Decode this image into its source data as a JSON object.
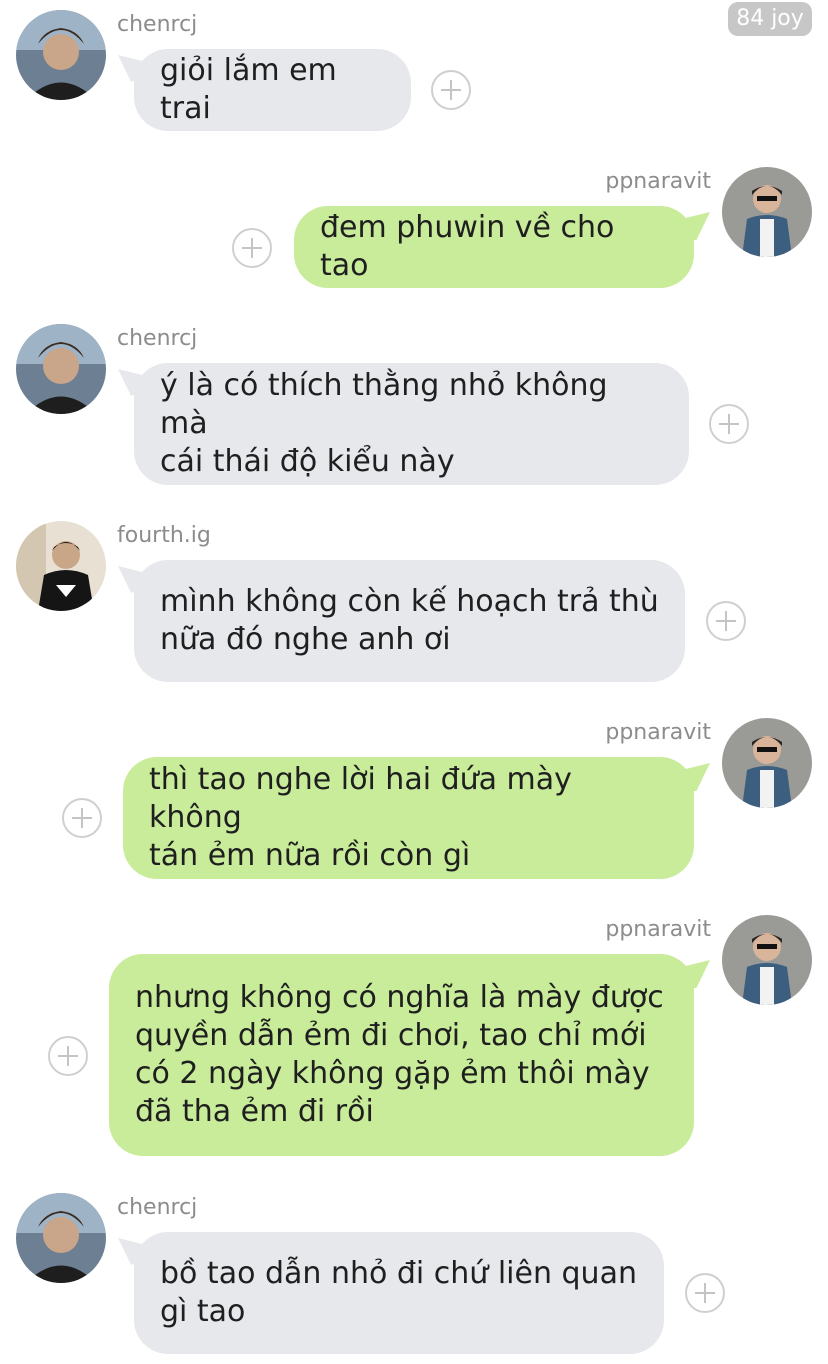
{
  "badge": "84 joy",
  "icons": {
    "add_reaction": "plus-circle-icon",
    "avatar": "profile-photo"
  },
  "colors": {
    "incoming_bubble": "#e6e8ec",
    "outgoing_bubble": "#c8ec9a",
    "username": "#8c8c8c",
    "badge_bg": "#c7c7c7"
  },
  "messages": [
    {
      "sender": "chenrcj",
      "direction": "incoming",
      "text": "giỏi lắm em trai"
    },
    {
      "sender": "ppnaravit",
      "direction": "outgoing",
      "text": "đem phuwin về cho tao"
    },
    {
      "sender": "chenrcj",
      "direction": "incoming",
      "text": "ý là có thích thằng nhỏ không mà\ncái thái độ kiểu này"
    },
    {
      "sender": "fourth.ig",
      "direction": "incoming",
      "text": "mình không còn kế hoạch trả thù\nnữa đó nghe anh ơi"
    },
    {
      "sender": "ppnaravit",
      "direction": "outgoing",
      "text": "thì tao nghe lời hai đứa mày không\ntán ẻm nữa rồi còn gì"
    },
    {
      "sender": "ppnaravit",
      "direction": "outgoing",
      "text": "nhưng không có nghĩa là mày được\nquyền dẫn ẻm đi chơi, tao chỉ mới\ncó 2 ngày không gặp ẻm thôi mày\nđã tha ẻm đi rồi"
    },
    {
      "sender": "chenrcj",
      "direction": "incoming",
      "text": "bồ tao dẫn nhỏ đi chứ liên quan\ngì tao"
    }
  ]
}
